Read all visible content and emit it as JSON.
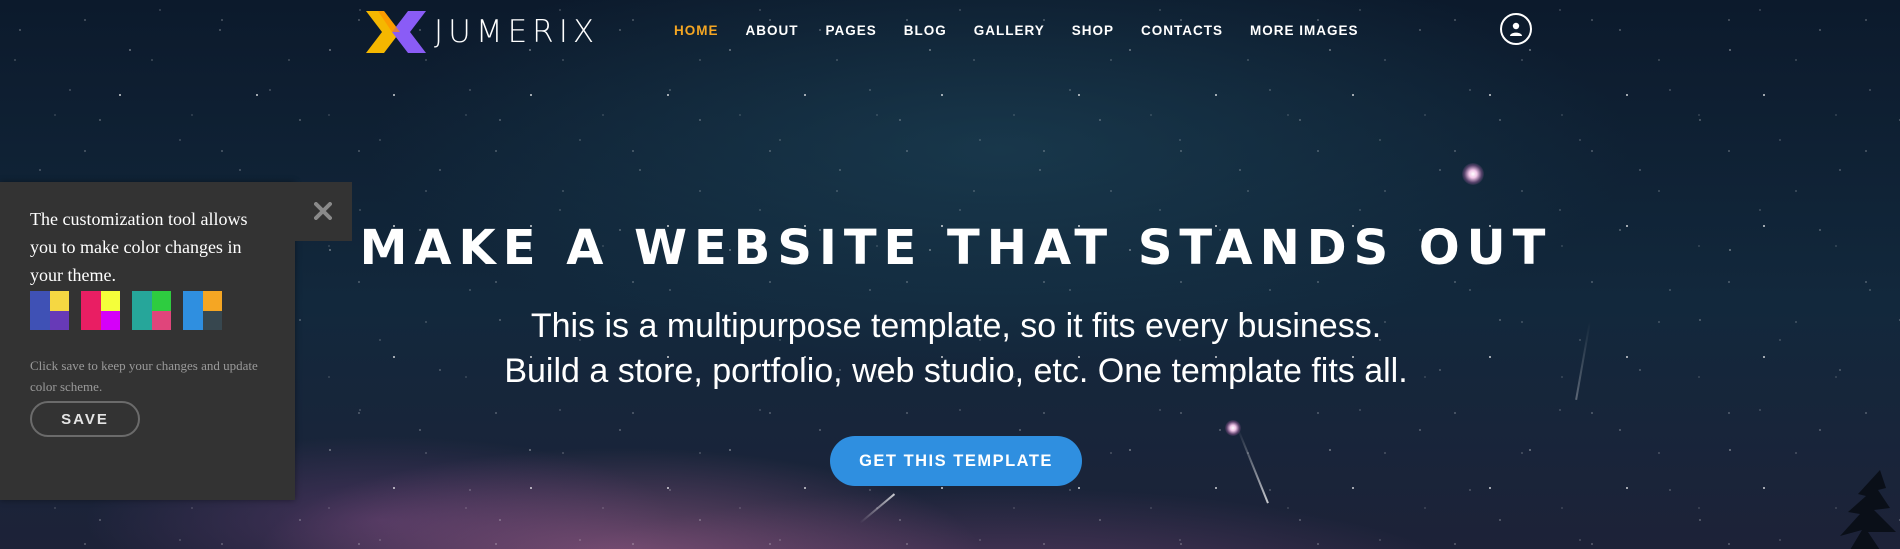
{
  "header": {
    "logo_text": "JUMERIX",
    "nav": [
      "HOME",
      "ABOUT",
      "PAGES",
      "BLOG",
      "GALLERY",
      "SHOP",
      "CONTACTS",
      "MORE IMAGES"
    ],
    "active_nav": "HOME"
  },
  "hero": {
    "title": "MAKE A WEBSITE THAT STANDS OUT",
    "subtitle_line1": "This is a multipurpose template, so it fits every business.",
    "subtitle_line2": "Build a store, portfolio, web studio, etc. One template fits all.",
    "cta_label": "GET THIS TEMPLATE"
  },
  "panel": {
    "text": "The customization tool allows you to make color changes in your theme.",
    "note": "Click save to keep your changes and update color scheme.",
    "save_label": "SAVE",
    "swatches": [
      {
        "name": "blue-yellow",
        "colors": [
          "#3f51b5",
          "#f5d742",
          "#3f51b5",
          "#673ab7"
        ]
      },
      {
        "name": "pink-magenta",
        "colors": [
          "#e91e63",
          "#f4ff3a",
          "#e91e63",
          "#d500f9"
        ]
      },
      {
        "name": "teal-green",
        "colors": [
          "#26a69a",
          "#2ecc40",
          "#26a69a",
          "#e0457b"
        ]
      },
      {
        "name": "blue-orange",
        "colors": [
          "#2f8fe0",
          "#f5a623",
          "#2f8fe0",
          "#37474f"
        ]
      }
    ]
  },
  "colors": {
    "accent": "#f5a623",
    "cta": "#2f8fe0",
    "panel_bg": "#333333"
  },
  "icons": [
    "logo-x-icon",
    "user-icon",
    "close-icon"
  ]
}
